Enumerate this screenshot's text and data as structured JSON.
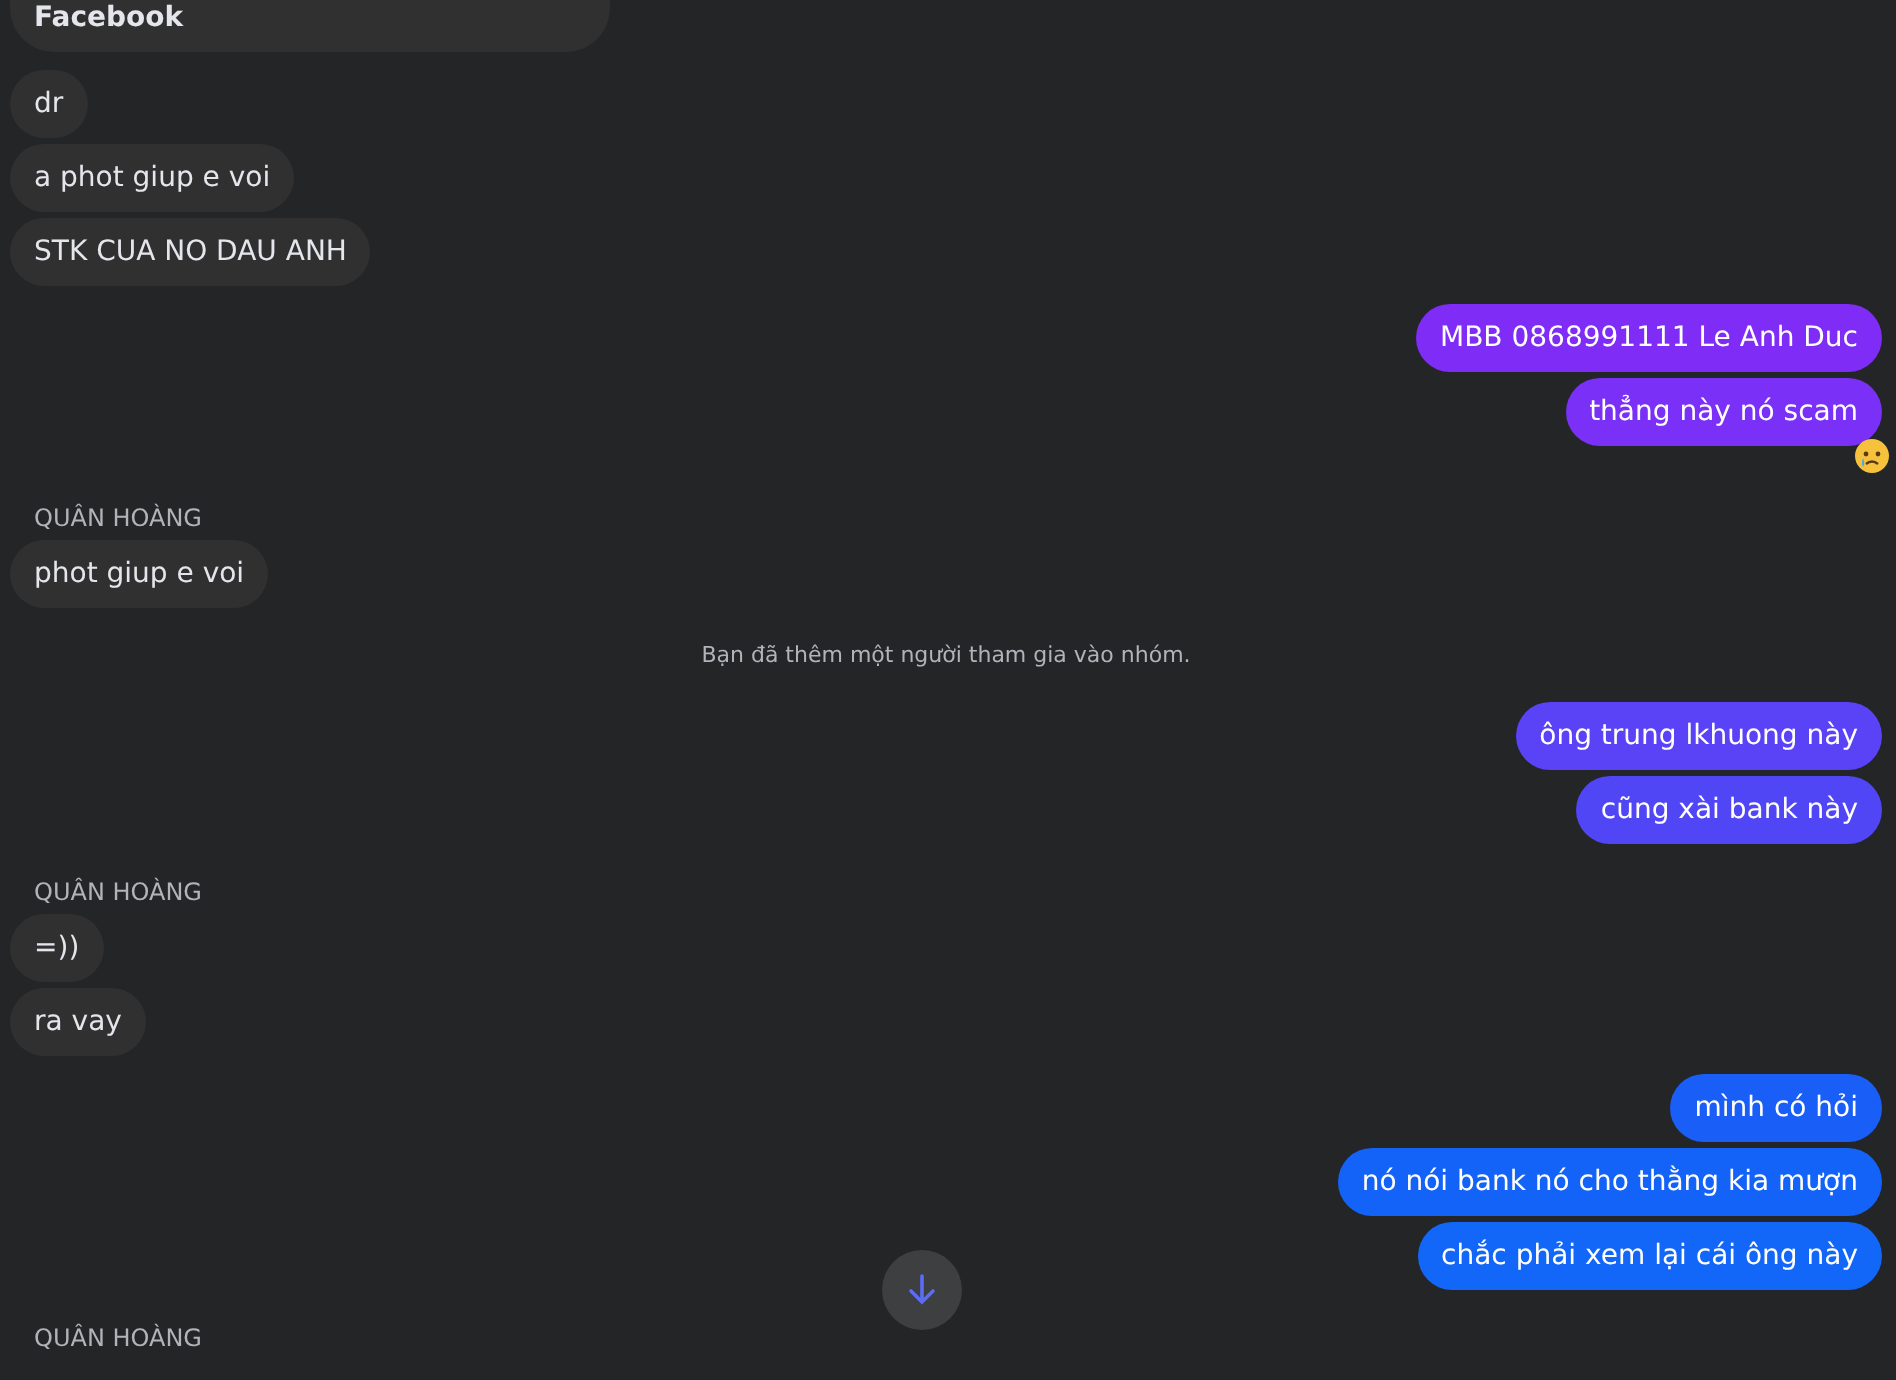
{
  "messages": [
    {
      "kind": "preview",
      "text": "Facebook"
    },
    {
      "kind": "incoming",
      "text": "dr"
    },
    {
      "kind": "incoming",
      "text": "a phot giup e voi"
    },
    {
      "kind": "incoming",
      "text": "STK CUA NO DAU ANH"
    },
    {
      "kind": "outgoing",
      "text": "MBB 0868991111 Le Anh Duc",
      "color": "#7f2cf6"
    },
    {
      "kind": "outgoing",
      "text": "thẳng này nó scam",
      "color": "#7a30f7",
      "reacted": true
    },
    {
      "kind": "sender",
      "text": "QUÂN HOÀNG"
    },
    {
      "kind": "incoming",
      "text": "phot giup e voi"
    },
    {
      "kind": "system",
      "text": "Bạn đã thêm một người tham gia vào nhóm."
    },
    {
      "kind": "outgoing",
      "text": "ông trung lkhuong này",
      "color": "#5a42f6"
    },
    {
      "kind": "outgoing",
      "text": "cũng xài bank này",
      "color": "#5046f6"
    },
    {
      "kind": "sender",
      "text": "QUÂN HOÀNG"
    },
    {
      "kind": "incoming",
      "text": "=))"
    },
    {
      "kind": "incoming",
      "text": "ra vay"
    },
    {
      "kind": "outgoing",
      "text": "mình có hỏi",
      "color": "#1a5ef8"
    },
    {
      "kind": "outgoing",
      "text": "nó nói bank nó cho thằng kia mượn",
      "color": "#1463f8"
    },
    {
      "kind": "outgoing",
      "text": "chắc phải xem lại cái ông này",
      "color": "#1266f8"
    },
    {
      "kind": "sender",
      "text": "QUÂN HOÀNG"
    }
  ],
  "scroll_button": {
    "kind": "down"
  }
}
